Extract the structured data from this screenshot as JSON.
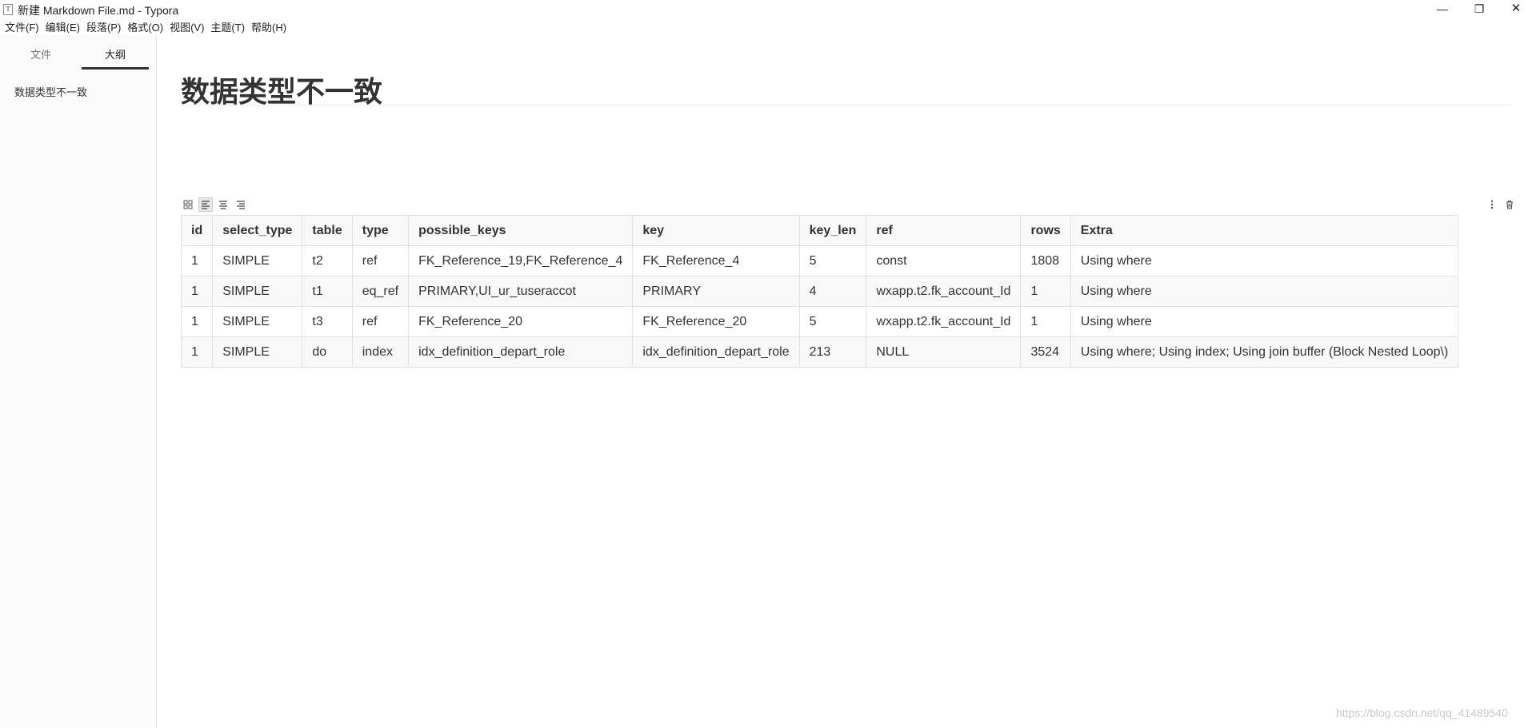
{
  "window": {
    "title": "新建 Markdown File.md - Typora",
    "icon_label": "T",
    "controls": {
      "minimize": "—",
      "maximize": "❐",
      "close": "✕"
    }
  },
  "menu": [
    "文件(F)",
    "编辑(E)",
    "段落(P)",
    "格式(O)",
    "视图(V)",
    "主题(T)",
    "帮助(H)"
  ],
  "sidebar": {
    "tabs": {
      "files": "文件",
      "outline": "大纲"
    },
    "active_tab": "outline",
    "outline_items": [
      "数据类型不一致"
    ]
  },
  "document": {
    "heading": "数据类型不一致",
    "table": {
      "headers": [
        "id",
        "select_type",
        "table",
        "type",
        "possible_keys",
        "key",
        "key_len",
        "ref",
        "rows",
        "Extra"
      ],
      "rows": [
        [
          "1",
          "SIMPLE",
          "t2",
          "ref",
          "FK_Reference_19,FK_Reference_4",
          "FK_Reference_4",
          "5",
          "const",
          "1808",
          "Using where"
        ],
        [
          "1",
          "SIMPLE",
          "t1",
          "eq_ref",
          "PRIMARY,UI_ur_tuseraccot",
          "PRIMARY",
          "4",
          "wxapp.t2.fk_account_Id",
          "1",
          "Using where"
        ],
        [
          "1",
          "SIMPLE",
          "t3",
          "ref",
          "FK_Reference_20",
          "FK_Reference_20",
          "5",
          "wxapp.t2.fk_account_Id",
          "1",
          "Using where"
        ],
        [
          "1",
          "SIMPLE",
          "do",
          "index",
          "idx_definition_depart_role",
          "idx_definition_depart_role",
          "213",
          "NULL",
          "3524",
          "Using where; Using index; Using join buffer (Block Nested Loop\\)"
        ]
      ]
    }
  },
  "watermark": "https://blog.csdn.net/qq_41489540"
}
